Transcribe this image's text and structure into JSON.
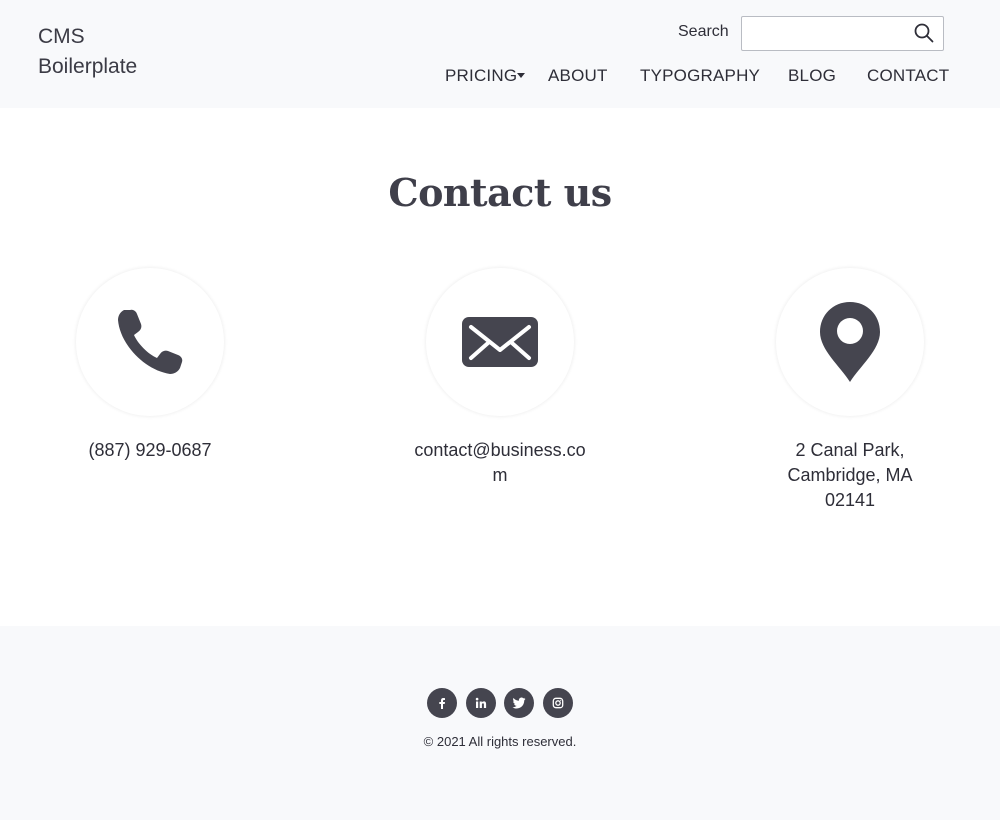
{
  "header": {
    "brand_line1": "CMS",
    "brand_line2": "Boilerplate",
    "search_label": "Search",
    "search_placeholder": "",
    "search_icon": "search-icon",
    "nav": [
      {
        "label": "PRICING",
        "has_dropdown": true
      },
      {
        "label": "ABOUT"
      },
      {
        "label": "TYPOGRAPHY"
      },
      {
        "label": "BLOG"
      },
      {
        "label": "CONTACT"
      }
    ]
  },
  "main": {
    "title": "Contact us",
    "contacts": [
      {
        "icon": "phone-icon",
        "text": "(887) 929-0687"
      },
      {
        "icon": "envelope-icon",
        "text": "contact@business.com"
      },
      {
        "icon": "map-pin-icon",
        "text": "2 Canal Park, Cambridge, MA 02141"
      }
    ]
  },
  "footer": {
    "social": [
      {
        "icon": "facebook-icon"
      },
      {
        "icon": "linkedin-icon"
      },
      {
        "icon": "twitter-icon"
      },
      {
        "icon": "instagram-icon"
      }
    ],
    "copyright": "© 2021 All rights reserved."
  },
  "colors": {
    "header_bg": "#f8f9fb",
    "footer_bg": "#f8f9fb",
    "icon_dark": "#45454f",
    "text": "#2e2e38"
  }
}
